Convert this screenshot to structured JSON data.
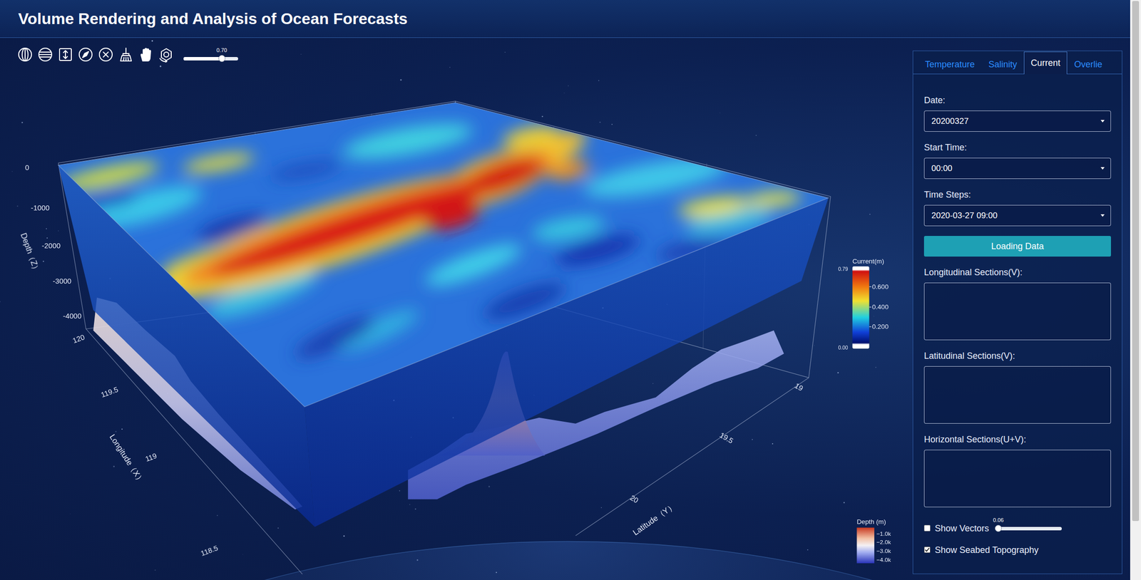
{
  "window": {
    "title": "Volume Rendering and Analysis of Ocean Forecasts"
  },
  "toolbar": {
    "opacity": {
      "reading": "0.70",
      "level": 0.7
    }
  },
  "view": {
    "depth_axis": {
      "title": "Depth（Z）",
      "ticks": [
        "0",
        "-1000",
        "-2000",
        "-3000",
        "-4000"
      ]
    },
    "longitude_axis": {
      "title": "Longitude（X）",
      "ticks": [
        "120",
        "119.5",
        "119",
        "118.5"
      ]
    },
    "latitude_axis": {
      "title": "Latitude（Y）",
      "ticks": [
        "19",
        "19.5",
        "20"
      ]
    },
    "current_legend": {
      "title": "Current(m)",
      "max": "0.79",
      "min": "0.00",
      "ticks": [
        "0.600",
        "0.400",
        "0.200"
      ]
    },
    "depth_legend": {
      "title": "Depth (m)",
      "ticks": [
        "−1.0k",
        "−2.0k",
        "−3.0k",
        "−4.0k"
      ]
    }
  },
  "panel": {
    "tabs": [
      {
        "label": "Temperature",
        "selected": false
      },
      {
        "label": "Salinity",
        "selected": false
      },
      {
        "label": "Current",
        "selected": true
      },
      {
        "label": "Overlie",
        "selected": false
      }
    ],
    "fields": [
      {
        "kind": "select",
        "label": "Date:",
        "value": "20200327"
      },
      {
        "kind": "select",
        "label": "Start Time:",
        "value": "00:00"
      },
      {
        "kind": "select",
        "label": "Time Steps:",
        "value": "2020-03-27 09:00"
      },
      {
        "kind": "button",
        "label": "Loading Data"
      },
      {
        "kind": "textarea",
        "label": "Longitudinal Sections(V):"
      },
      {
        "kind": "textarea",
        "label": "Latitudinal Sections(V):"
      },
      {
        "kind": "textarea",
        "label": "Horizontal Sections(U+V):"
      }
    ],
    "options": [
      {
        "kind": "slider",
        "label": "Show Vectors",
        "checked": false,
        "reading": "0.06",
        "level": 0.03
      },
      {
        "kind": "plain",
        "label": "Show Seabed Topography",
        "checked": true
      }
    ]
  },
  "scrollbar": {
    "level": 0.9
  }
}
